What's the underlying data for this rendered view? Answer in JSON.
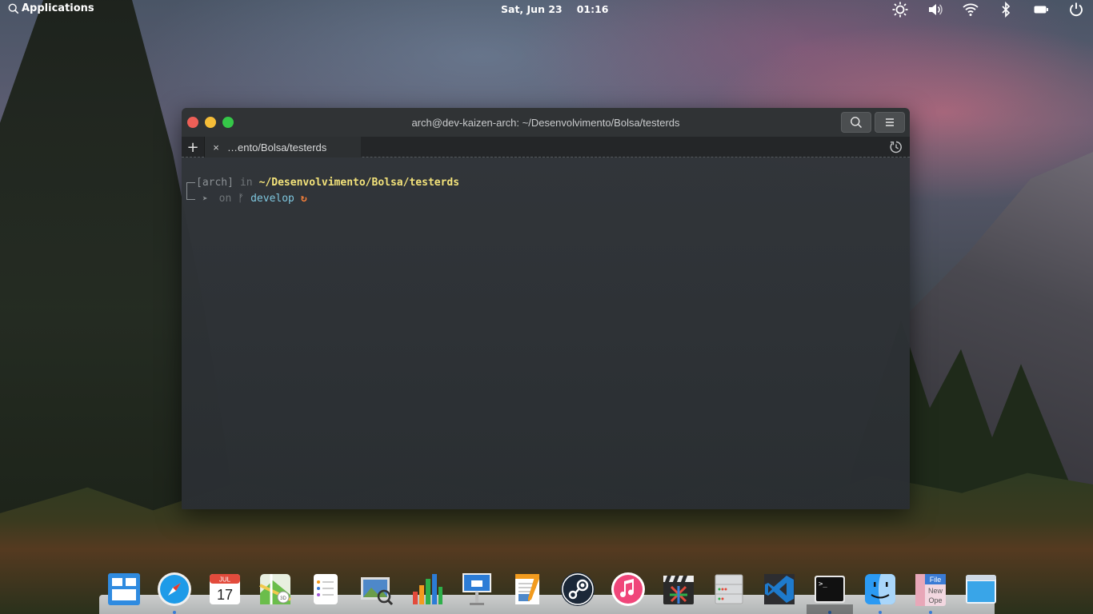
{
  "top_panel": {
    "applications_label": "Applications",
    "date": "Sat, Jun 23",
    "time": "01:16"
  },
  "terminal": {
    "title": "arch@dev-kaizen-arch: ~/Desenvolvimento/Bolsa/testerds",
    "new_tab_label": "+",
    "tab_label": "…ento/Bolsa/testerds",
    "tab_close": "×",
    "prompt": {
      "user": "[arch]",
      "in_word": "in",
      "path": "~/Desenvolvimento/Bolsa/testerds",
      "arrow": "➤",
      "on_word": "on",
      "branch_icon": "ᚠ",
      "branch": "develop",
      "sync_icon": "↻"
    }
  },
  "dock": {
    "items": [
      {
        "name": "multitasking-view",
        "color": "#2f8be0"
      },
      {
        "name": "safari",
        "color": "#1e9be8"
      },
      {
        "name": "calendar",
        "month": "JUL",
        "day": "17"
      },
      {
        "name": "maps",
        "color": "#6bbd4b"
      },
      {
        "name": "reminders",
        "color": "#ffffff"
      },
      {
        "name": "preview",
        "color": "#4e88c9"
      },
      {
        "name": "numbers",
        "color": "#2eaf4a"
      },
      {
        "name": "keynote",
        "color": "#2c7cd6"
      },
      {
        "name": "pages",
        "color": "#f29b1e"
      },
      {
        "name": "steam",
        "color": "#1b2838"
      },
      {
        "name": "itunes",
        "color": "#f0467a"
      },
      {
        "name": "final-cut-pro",
        "color": "#2a2a2a"
      },
      {
        "name": "system-information",
        "color": "#d8dadc"
      },
      {
        "name": "visual-studio-code",
        "color": "#1e7acc"
      },
      {
        "name": "terminal",
        "color": "#111111"
      },
      {
        "name": "finder",
        "color": "#2b9af3"
      },
      {
        "name": "file-manager",
        "label_top": "File",
        "label_mid": "New",
        "label_bot": "Ope"
      },
      {
        "name": "desktop",
        "color": "#39a5e8"
      }
    ]
  }
}
